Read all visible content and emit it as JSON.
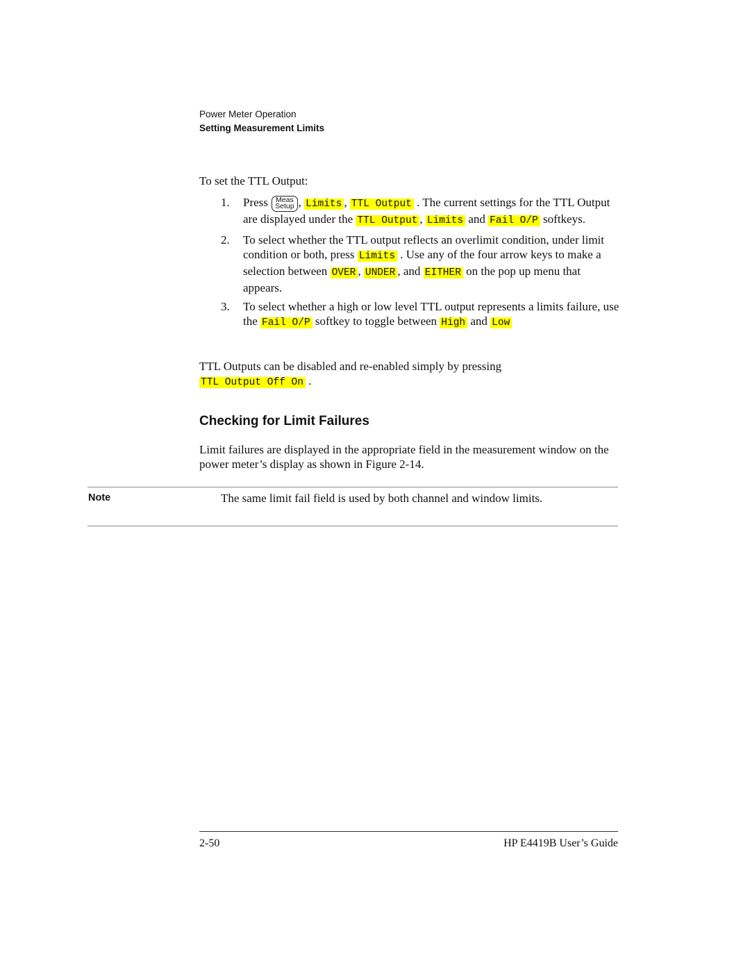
{
  "header": {
    "chapter": "Power Meter Operation",
    "section": "Setting Measurement Limits"
  },
  "intro": "To set the TTL Output:",
  "steps": [
    {
      "number": "1.",
      "press": "Press",
      "key_top": "Meas",
      "key_bottom": "Setup",
      "sep1": ",",
      "softkey_limits": "Limits",
      "sep2": ",",
      "softkey_ttl_output": "TTL Output",
      "text_a": ". The current settings for the TTL Output are displayed under the",
      "softkey_ttl_output_2": "TTL Output",
      "sep3": ",",
      "softkey_limits_2": "Limits",
      "text_b": "and",
      "softkey_fail_op": "Fail O/P",
      "text_c": "softkeys."
    },
    {
      "number": "2.",
      "text_a": "To select whether the TTL output reflects an overlimit condition, under limit condition or both, press",
      "softkey_limits": "Limits",
      "text_b": ". Use any of the four arrow keys to make a selection between",
      "opt_over": "OVER",
      "sep1": ",",
      "opt_under": "UNDER",
      "text_c": ", and",
      "opt_either": "EITHER",
      "text_d": "on the pop up menu that appears."
    },
    {
      "number": "3.",
      "text_a": "To select whether a high or low level TTL output represents a limits failure, use the",
      "softkey_fail_op": "Fail O/P",
      "text_b": "softkey to toggle between",
      "opt_high": "High",
      "text_c": "and",
      "opt_low": "Low"
    }
  ],
  "ttl_para": {
    "text": "TTL Outputs can be disabled and re-enabled simply by pressing",
    "softkey": "TTL Output Off On",
    "end": "."
  },
  "section_heading": "Checking for Limit Failures",
  "limit_para": "Limit failures are displayed in the appropriate field in the measurement window on the power meter’s display as shown in Figure 2-14.",
  "note": {
    "label": "Note",
    "text": "The same limit fail field is used by both channel and window limits."
  },
  "footer": {
    "page": "2-50",
    "title": "HP E4419B User’s Guide"
  },
  "colors": {
    "softkey_highlight": "#ffff00"
  }
}
